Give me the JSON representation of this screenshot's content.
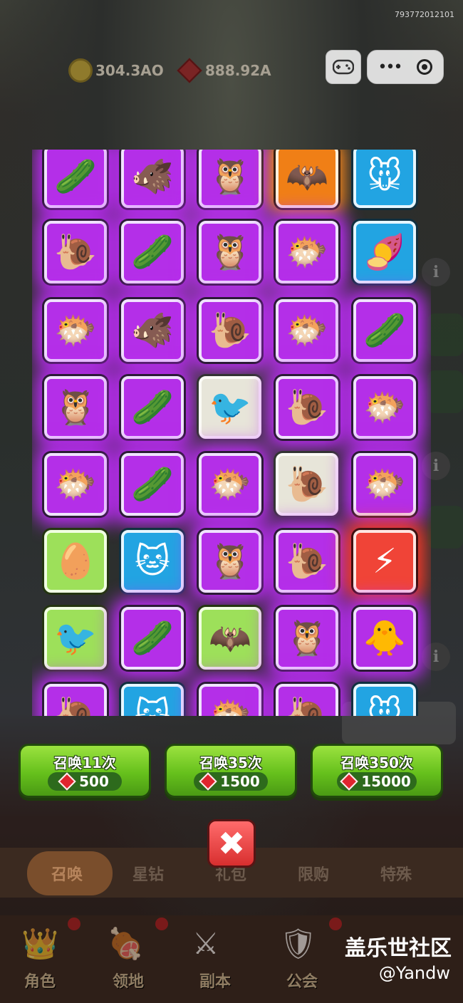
{
  "uid": "793772012101",
  "currency": {
    "coins": "304.3AO",
    "gems": "888.92A"
  },
  "capsule": {
    "gamepad_icon": "gamepad-icon",
    "more_icon": "more-dots-icon",
    "close_icon": "target-circle-icon"
  },
  "grid_rows": [
    [
      {
        "rarity": "purple",
        "icon": "🥒"
      },
      {
        "rarity": "purple",
        "icon": "🐗"
      },
      {
        "rarity": "purple",
        "icon": "🦉"
      },
      {
        "rarity": "orange",
        "icon": "🦇"
      },
      {
        "rarity": "blue",
        "icon": "🐭"
      }
    ],
    [
      {
        "rarity": "purple",
        "icon": "🐌"
      },
      {
        "rarity": "purple",
        "icon": "🥒"
      },
      {
        "rarity": "purple",
        "icon": "🦉"
      },
      {
        "rarity": "purple",
        "icon": "🐡"
      },
      {
        "rarity": "blue",
        "icon": "🍠"
      }
    ],
    [
      {
        "rarity": "purple",
        "icon": "🐡"
      },
      {
        "rarity": "purple",
        "icon": "🐗"
      },
      {
        "rarity": "purple",
        "icon": "🐌"
      },
      {
        "rarity": "purple",
        "icon": "🐡"
      },
      {
        "rarity": "purple",
        "icon": "🥒"
      }
    ],
    [
      {
        "rarity": "purple",
        "icon": "🦉"
      },
      {
        "rarity": "purple",
        "icon": "🥒"
      },
      {
        "rarity": "white",
        "icon": "🐦"
      },
      {
        "rarity": "purple",
        "icon": "🐌"
      },
      {
        "rarity": "purple",
        "icon": "🐡"
      }
    ],
    [
      {
        "rarity": "purple",
        "icon": "🐡"
      },
      {
        "rarity": "purple",
        "icon": "🥒"
      },
      {
        "rarity": "purple",
        "icon": "🐡"
      },
      {
        "rarity": "white",
        "icon": "🐌"
      },
      {
        "rarity": "purple",
        "icon": "🐡"
      }
    ],
    [
      {
        "rarity": "green",
        "icon": "🥚"
      },
      {
        "rarity": "blue",
        "icon": "🐱"
      },
      {
        "rarity": "purple",
        "icon": "🦉"
      },
      {
        "rarity": "purple",
        "icon": "🐌"
      },
      {
        "rarity": "red",
        "icon": "⚡"
      }
    ],
    [
      {
        "rarity": "green",
        "icon": "🐦"
      },
      {
        "rarity": "purple",
        "icon": "🥒"
      },
      {
        "rarity": "green",
        "icon": "🦇"
      },
      {
        "rarity": "purple",
        "icon": "🦉"
      },
      {
        "rarity": "purple",
        "icon": "🐥"
      }
    ],
    [
      {
        "rarity": "purple",
        "icon": "🐌"
      },
      {
        "rarity": "blue",
        "icon": "🐱"
      },
      {
        "rarity": "purple",
        "icon": "🐡"
      },
      {
        "rarity": "purple",
        "icon": "🐌"
      },
      {
        "rarity": "blue",
        "icon": "🐭"
      }
    ]
  ],
  "summon_buttons": [
    {
      "label": "召唤11次",
      "cost": "500"
    },
    {
      "label": "召唤35次",
      "cost": "1500"
    },
    {
      "label": "召唤350次",
      "cost": "15000"
    }
  ],
  "close_label": "✖",
  "tabs": [
    "召唤",
    "星钻",
    "礼包",
    "限购",
    "特殊"
  ],
  "nav": [
    "角色",
    "领地",
    "副本",
    "公会"
  ],
  "watermark": {
    "line1": "盖乐世社区",
    "line2": "@Yandw"
  }
}
